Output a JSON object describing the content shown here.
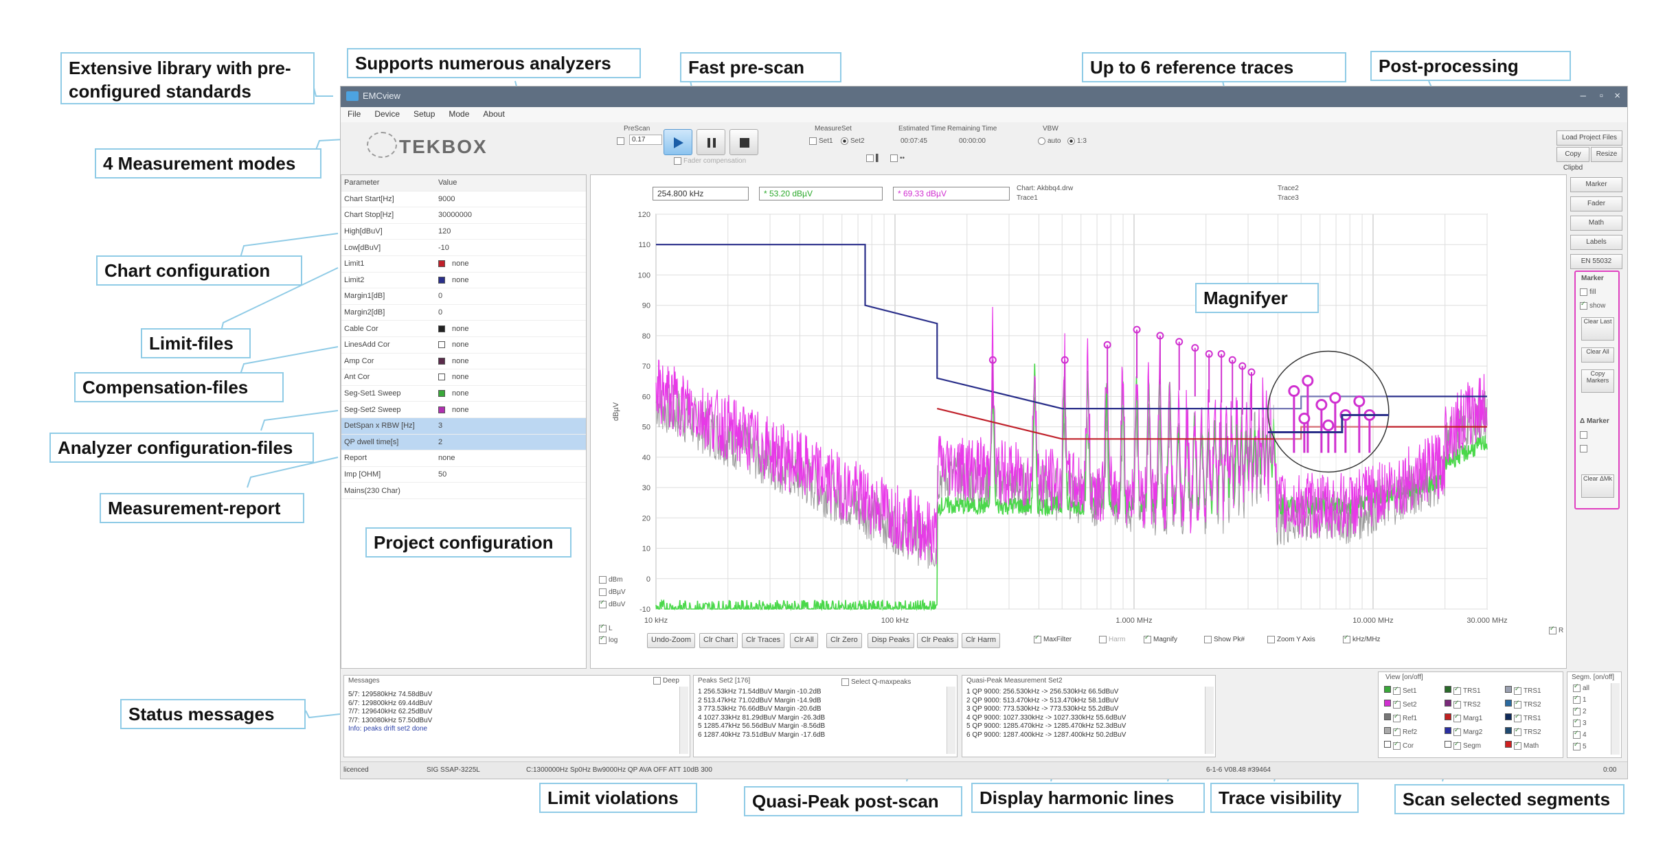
{
  "callouts": {
    "library": "Extensive library with pre-configured standards",
    "analyzers": "Supports numerous analyzers",
    "prescan": "Fast pre-scan",
    "reftraces": "Up to 6 reference traces",
    "postprocessing": "Post-processing",
    "modes": "4 Measurement modes",
    "chartconfig": "Chart configuration",
    "limitfiles": "Limit-files",
    "compfiles": "Compensation-files",
    "analyzerconfig": "Analyzer configuration-files",
    "report": "Measurement-report",
    "project": "Project configuration",
    "magnifyer": "Magnifyer",
    "status": "Status messages",
    "limitviolations": "Limit violations",
    "qppostscan": "Quasi-Peak post-scan",
    "harmonic": "Display harmonic lines",
    "tracevis": "Trace visibility",
    "segments": "Scan selected segments"
  },
  "window": {
    "title": "EMCview"
  },
  "menu": [
    "File",
    "Device",
    "Setup",
    "Mode",
    "About"
  ],
  "toolbar": {
    "logo": "TEKBOX",
    "prescan_label": "PreScan",
    "prescan_value": "0.17",
    "fader_comp": "Fader compensation",
    "measureset_label": "MeasureSet",
    "set1": "Set1",
    "set2": "Set2",
    "est_time_label": "Estimated Time",
    "est_time": "00:07:45",
    "rem_time_label": "Remaining Time",
    "rem_time": "00:00:00",
    "vbw_label": "VBW",
    "vbw_auto": "auto",
    "vbw_ratio": "1:3",
    "load_project": "Load Project Files",
    "copy_clipbd": "Copy Clipbd",
    "resize": "Resize"
  },
  "params": {
    "header": [
      "Parameter",
      "Value"
    ],
    "rows": [
      {
        "name": "Chart Start[Hz]",
        "value": "9000"
      },
      {
        "name": "Chart Stop[Hz]",
        "value": "30000000"
      },
      {
        "name": "High[dBuV]",
        "value": "120"
      },
      {
        "name": "Low[dBuV]",
        "value": "-10"
      },
      {
        "name": "Limit1",
        "value": "none",
        "swatch": "#c0202a"
      },
      {
        "name": "Limit2",
        "value": "none",
        "swatch": "#2a2f8a"
      },
      {
        "name": "Margin1[dB]",
        "value": "0"
      },
      {
        "name": "Margin2[dB]",
        "value": "0"
      },
      {
        "name": "Cable Cor",
        "value": "none",
        "swatch": "#222222"
      },
      {
        "name": "LinesAdd Cor",
        "value": "none",
        "swatch": "#ffffff"
      },
      {
        "name": "Amp Cor",
        "value": "none",
        "swatch": "#5a2a4a"
      },
      {
        "name": "Ant Cor",
        "value": "none",
        "swatch": "#ffffff"
      },
      {
        "name": "Seg-Set1 Sweep",
        "value": "none",
        "swatch": "#3aa83a"
      },
      {
        "name": "Seg-Set2 Sweep",
        "value": "none",
        "swatch": "#b030b0"
      },
      {
        "name": "DetSpan x RBW [Hz]",
        "value": "3",
        "selected": true
      },
      {
        "name": "QP dwell time[s]",
        "value": "2",
        "selected": true
      },
      {
        "name": "Report",
        "value": "none"
      },
      {
        "name": "Imp [OHM]",
        "value": "50"
      },
      {
        "name": "Mains(230 Char)",
        "value": ""
      }
    ]
  },
  "chart_top": {
    "freq_readout": "254.800 kHz",
    "green_readout": "* 53.20 dBµV",
    "magenta_readout": "* 69.33 dBµV",
    "chart_file": "Chart: Akbbq4.drw",
    "trace1": "Trace1",
    "trace2": "Trace2",
    "trace3": "Trace3"
  },
  "chart_data": {
    "type": "line",
    "xscale": "log",
    "xlim_hz": [
      10000,
      30000000
    ],
    "ylim": [
      -10,
      120
    ],
    "ylabel": "dBµV",
    "y_ticks": [
      "120",
      "110",
      "100",
      "90",
      "80",
      "70",
      "60",
      "50",
      "40",
      "30",
      "20",
      "10",
      "0",
      "-10"
    ],
    "x_ticks": [
      "10 kHz",
      "100 kHz",
      "1.000 MHz",
      "10.000 MHz",
      "30.000 MHz"
    ],
    "grid": true,
    "unit_options": [
      "dBm",
      "dBµV",
      "dBuV"
    ],
    "limit_lines": [
      {
        "color": "#2a2f8a",
        "points": [
          [
            10000,
            110
          ],
          [
            75000,
            110
          ],
          [
            75000,
            90
          ],
          [
            150000,
            84
          ],
          [
            150000,
            66
          ],
          [
            500000,
            56
          ],
          [
            5000000,
            56
          ],
          [
            5000000,
            60
          ],
          [
            30000000,
            60
          ]
        ]
      },
      {
        "color": "#c0202a",
        "points": [
          [
            150000,
            56
          ],
          [
            500000,
            46
          ],
          [
            5000000,
            46
          ],
          [
            5000000,
            50
          ],
          [
            30000000,
            50
          ]
        ]
      }
    ],
    "series": [
      {
        "color": "#e838e8",
        "description": "Set2 peak sweep, 9 kHz start near 62 dBµV decaying to ~15 dBµV at 150 kHz, harmonic spikes up to ~84 dBµV between 150 kHz and 3 MHz, rising to ~60 dBµV near 30 MHz"
      },
      {
        "color": "#4ad84a",
        "description": "Set1 sweep, baseline ~25 dBµV from 150 kHz, harmonic spikes, rising to ~45 dBµV near 30 MHz"
      },
      {
        "color": "#9a9a9a",
        "description": "Reference trace, similar shape underneath"
      }
    ]
  },
  "chart_buttons": [
    "Undo-Zoom",
    "Clr Chart",
    "Clr Traces",
    "Clr All",
    "Clr Zero",
    "Disp Peaks",
    "Clr Peaks",
    "Clr Harm"
  ],
  "chart_checks": [
    {
      "label": "L",
      "on": true
    },
    {
      "label": "log",
      "on": true
    },
    {
      "label": "MaxFilter",
      "on": true
    },
    {
      "label": "Harm",
      "on": false
    },
    {
      "label": "Magnify",
      "on": true
    },
    {
      "label": "Show Pk#",
      "on": false
    },
    {
      "label": "Zoom Y Axis",
      "on": false
    },
    {
      "label": "kHz/MHz",
      "on": true
    },
    {
      "label": "R",
      "on": true
    }
  ],
  "right_buttons": [
    "Marker",
    "Fader",
    "Math",
    "Labels",
    "EN 55032"
  ],
  "marker_panel": {
    "title": "Marker",
    "fill": "fill",
    "show": "show",
    "clear_last": "Clear Last",
    "clear_all": "Clear All",
    "copy_markers": "Copy Markers",
    "delta_marker": "Δ Marker",
    "clear_dm": "Clear ΔMk"
  },
  "messages": {
    "title": "Messages",
    "deep": "Deep",
    "lines": [
      "5/7: 129580kHz 74.58dBuV",
      "6/7: 129800kHz 69.44dBuV",
      "7/7: 129640kHz 62.25dBuV",
      "7/7: 130080kHz 57.50dBuV",
      "Info: peaks drift set2 done"
    ]
  },
  "peaks": {
    "title": "Peaks Set2 [176]",
    "select_qp": "Select Q-maxpeaks",
    "lines": [
      "1  256.53kHz 71.54dBuV Margin -10.2dB",
      "2  513.47kHz 71.02dBuV Margin -14.9dB",
      "3  773.53kHz 76.66dBuV Margin -20.6dB",
      "4  1027.33kHz 81.29dBuV Margin -26.3dB",
      "5  1285.47kHz 56.56dBuV Margin -8.56dB",
      "6  1287.40kHz 73.51dBuV Margin -17.6dB"
    ]
  },
  "qp": {
    "title": "Quasi-Peak Measurement Set2",
    "lines": [
      "1  QP 9000: 256.530kHz -> 256.530kHz 66.5dBuV",
      "2  QP 9000: 513.470kHz -> 513.470kHz 58.1dBuV",
      "3  QP 9000: 773.530kHz -> 773.530kHz 55.2dBuV",
      "4  QP 9000: 1027.330kHz -> 1027.330kHz 55.6dBuV",
      "5  QP 9000: 1285.470kHz -> 1285.470kHz 52.3dBuV",
      "6  QP 9000: 1287.400kHz -> 1287.400kHz 50.2dBuV"
    ]
  },
  "view": {
    "title": "View [on/off]",
    "items": [
      {
        "label": "Set1",
        "color": "#3aa83a"
      },
      {
        "label": "TRS1",
        "color": "#2a6a2a"
      },
      {
        "label": "TRS1",
        "color": "#9aa0b0"
      },
      {
        "label": "Set2",
        "color": "#d030d0"
      },
      {
        "label": "TRS2",
        "color": "#7a2a7a"
      },
      {
        "label": "TRS2",
        "color": "#2a6aa0"
      },
      {
        "label": "Ref1",
        "color": "#777777"
      },
      {
        "label": "Marg1",
        "color": "#c02020"
      },
      {
        "label": "TRS1",
        "color": "#102a5a"
      },
      {
        "label": "Ref2",
        "color": "#aaaaaa"
      },
      {
        "label": "Marg2",
        "color": "#2a2fa0"
      },
      {
        "label": "TRS2",
        "color": "#204a70"
      },
      {
        "label": "Cor",
        "color": "#ffffff"
      },
      {
        "label": "Segm",
        "color": "#ffffff"
      },
      {
        "label": "Math",
        "color": "#d02020"
      }
    ]
  },
  "segm": {
    "title": "Segm. [on/off]",
    "items": [
      "all",
      "1",
      "2",
      "3",
      "4",
      "5"
    ]
  },
  "statusbar": {
    "licensed": "licenced",
    "analyzer": "SIG SSAP-3225L",
    "params": "C:1300000Hz Sp0Hz Bw9000Hz QP AVA OFF ATT 10dB 300",
    "version": "6-1-6 V08.48 #39464",
    "time": "0:00"
  }
}
